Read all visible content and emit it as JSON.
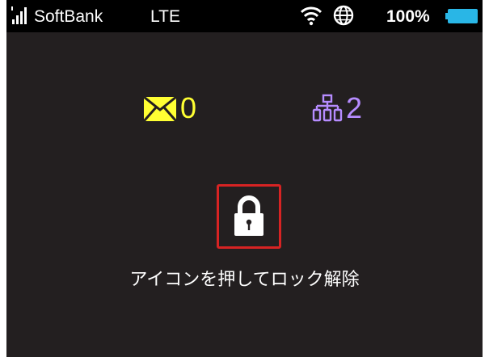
{
  "status_bar": {
    "signal_icon": "signal-strength-icon",
    "carrier": "SoftBank",
    "network": "LTE",
    "wifi_icon": "wifi-icon",
    "globe_icon": "globe-icon",
    "battery_percent": "100%",
    "battery_level": 1.0,
    "battery_icon": "battery-icon"
  },
  "notifications": {
    "mail_icon": "mail-icon",
    "mail_count": "0",
    "mail_color": "#ffff33",
    "connected_devices_icon": "connected-devices-icon",
    "connected_devices_count": "2",
    "devices_color": "#b68cff"
  },
  "lock": {
    "icon": "padlock-icon",
    "highlight_color": "#d72323",
    "hint": "アイコンを押してロック解除"
  },
  "colors": {
    "screen_background": "#231f20",
    "status_bar_background": "#000000",
    "battery_fill": "#29b6e6"
  }
}
